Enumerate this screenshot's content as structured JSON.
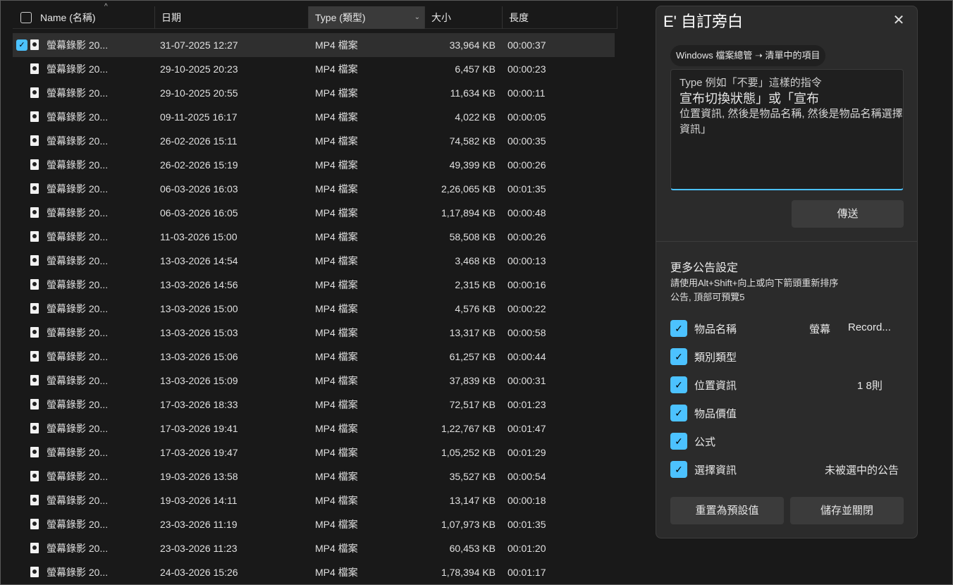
{
  "file_list": {
    "columns": {
      "name": "Name (名稱)",
      "date": "日期",
      "type": "Type (類型)",
      "size": "大小",
      "length": "長度"
    },
    "rows": [
      {
        "name": "螢幕錄影 20...",
        "date": "31-07-2025 12:27",
        "type": "MP4 檔案",
        "size": "33,964 KB",
        "length": "00:00:37",
        "selected": true
      },
      {
        "name": "螢幕錄影 20...",
        "date": "29-10-2025 20:23",
        "type": "MP4 檔案",
        "size": "6,457 KB",
        "length": "00:00:23"
      },
      {
        "name": "螢幕錄影 20...",
        "date": "29-10-2025 20:55",
        "type": "MP4 檔案",
        "size": "11,634 KB",
        "length": "00:00:11"
      },
      {
        "name": "螢幕錄影 20...",
        "date": "09-11-2025 16:17",
        "type": "MP4 檔案",
        "size": "4,022 KB",
        "length": "00:00:05"
      },
      {
        "name": "螢幕錄影 20...",
        "date": "26-02-2026 15:11",
        "type": "MP4 檔案",
        "size": "74,582 KB",
        "length": "00:00:35"
      },
      {
        "name": "螢幕錄影 20...",
        "date": "26-02-2026 15:19",
        "type": "MP4 檔案",
        "size": "49,399 KB",
        "length": "00:00:26"
      },
      {
        "name": "螢幕錄影 20...",
        "date": "06-03-2026 16:03",
        "type": "MP4 檔案",
        "size": "2,26,065 KB",
        "length": "00:01:35"
      },
      {
        "name": "螢幕錄影 20...",
        "date": "06-03-2026 16:05",
        "type": "MP4 檔案",
        "size": "1,17,894 KB",
        "length": "00:00:48"
      },
      {
        "name": "螢幕錄影 20...",
        "date": "11-03-2026 15:00",
        "type": "MP4 檔案",
        "size": "58,508 KB",
        "length": "00:00:26"
      },
      {
        "name": "螢幕錄影 20...",
        "date": "13-03-2026 14:54",
        "type": "MP4 檔案",
        "size": "3,468 KB",
        "length": "00:00:13"
      },
      {
        "name": "螢幕錄影 20...",
        "date": "13-03-2026 14:56",
        "type": "MP4 檔案",
        "size": "2,315 KB",
        "length": "00:00:16"
      },
      {
        "name": "螢幕錄影 20...",
        "date": "13-03-2026 15:00",
        "type": "MP4 檔案",
        "size": "4,576 KB",
        "length": "00:00:22"
      },
      {
        "name": "螢幕錄影 20...",
        "date": "13-03-2026 15:03",
        "type": "MP4 檔案",
        "size": "13,317 KB",
        "length": "00:00:58"
      },
      {
        "name": "螢幕錄影 20...",
        "date": "13-03-2026 15:06",
        "type": "MP4 檔案",
        "size": "61,257 KB",
        "length": "00:00:44"
      },
      {
        "name": "螢幕錄影 20...",
        "date": "13-03-2026 15:09",
        "type": "MP4 檔案",
        "size": "37,839 KB",
        "length": "00:00:31"
      },
      {
        "name": "螢幕錄影 20...",
        "date": "17-03-2026 18:33",
        "type": "MP4 檔案",
        "size": "72,517 KB",
        "length": "00:01:23"
      },
      {
        "name": "螢幕錄影 20...",
        "date": "17-03-2026 19:41",
        "type": "MP4 檔案",
        "size": "1,22,767 KB",
        "length": "00:01:47"
      },
      {
        "name": "螢幕錄影 20...",
        "date": "17-03-2026 19:47",
        "type": "MP4 檔案",
        "size": "1,05,252 KB",
        "length": "00:01:29"
      },
      {
        "name": "螢幕錄影 20...",
        "date": "19-03-2026 13:58",
        "type": "MP4 檔案",
        "size": "35,527 KB",
        "length": "00:00:54"
      },
      {
        "name": "螢幕錄影 20...",
        "date": "19-03-2026 14:11",
        "type": "MP4 檔案",
        "size": "13,147 KB",
        "length": "00:00:18"
      },
      {
        "name": "螢幕錄影 20...",
        "date": "23-03-2026 11:19",
        "type": "MP4 檔案",
        "size": "1,07,973 KB",
        "length": "00:01:35"
      },
      {
        "name": "螢幕錄影 20...",
        "date": "23-03-2026 11:23",
        "type": "MP4 檔案",
        "size": "60,453 KB",
        "length": "00:01:20"
      },
      {
        "name": "螢幕錄影 20...",
        "date": "24-03-2026 15:26",
        "type": "MP4 檔案",
        "size": "1,78,394 KB",
        "length": "00:01:17"
      }
    ]
  },
  "dialog": {
    "title": "E' 自訂旁白",
    "close_glyph": "✕",
    "context_chip": "Windows 檔案總管 ➝ 清單中的項目",
    "textarea": {
      "line1": "Type 例如「不要」這樣的指令",
      "line2": "宣布切換狀態」或「宣布",
      "line3": "位置資訊, 然後是物品名稱, 然後是物品名稱選擇資訊」"
    },
    "send_label": "傳送",
    "more_title": "更多公告設定",
    "more_desc": "請使用Alt+Shift+向上或向下箭頭重新排序公告, 頂部可預覽5",
    "options": [
      {
        "label": "物品名稱",
        "value": "螢幕",
        "value2": "Record...",
        "checked": true
      },
      {
        "label": "類別類型",
        "value": "",
        "checked": true
      },
      {
        "label": "位置資訊",
        "value": "1 8則",
        "checked": true
      },
      {
        "label": "物品價值",
        "value": "",
        "checked": true
      },
      {
        "label": "公式",
        "value": "",
        "checked": true
      },
      {
        "label": "選擇資訊",
        "value": "未被選中的公告",
        "checked": true
      }
    ],
    "reset_label": "重置為預設值",
    "save_label": "儲存並關閉"
  },
  "colors": {
    "accent": "#4cc2ff",
    "background": "#191919",
    "dialog_bg": "#2b2b2b"
  }
}
